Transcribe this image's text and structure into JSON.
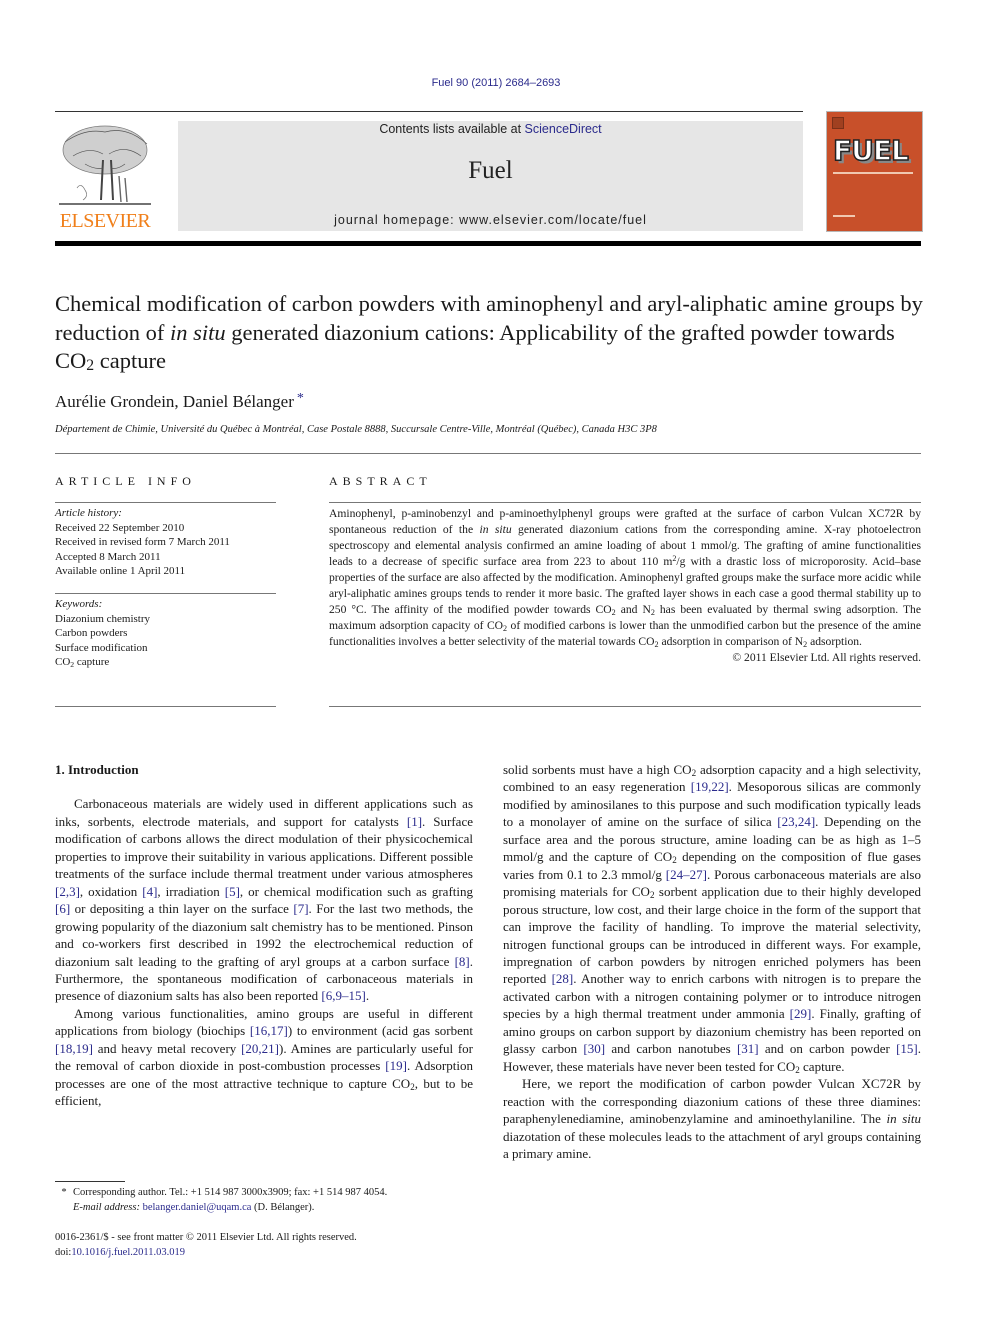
{
  "header": {
    "citation": "Fuel 90 (2011) 2684–2693",
    "contents_prefix": "Contents lists available at ",
    "contents_link": "ScienceDirect",
    "journal_name": "Fuel",
    "homepage": "journal homepage: www.elsevier.com/locate/fuel",
    "publisher_logo_text": "ELSEVIER",
    "cover_title": "FUEL",
    "colors": {
      "publisher_orange": "#f07f1a",
      "cover_background": "#c8502a",
      "banner_gray": "#e6e6e6",
      "link_blue": "#2b2b8c"
    }
  },
  "article": {
    "title_part1": "Chemical modification of carbon powders with aminophenyl and aryl-aliphatic amine groups by reduction of ",
    "title_italic": "in situ",
    "title_part2": " generated diazonium cations: Applicability of the grafted powder towards CO",
    "title_sub": "2",
    "title_part3": " capture",
    "authors": "Aurélie Grondein, Daniel Bélanger",
    "author_marker": "*",
    "affiliation": "Département de Chimie, Université du Québec à Montréal, Case Postale 8888, Succursale Centre-Ville, Montréal (Québec), Canada H3C 3P8"
  },
  "article_info": {
    "heading": "ARTICLE INFO",
    "history_label": "Article history:",
    "history": [
      "Received 22 September 2010",
      "Received in revised form 7 March 2011",
      "Accepted 8 March 2011",
      "Available online 1 April 2011"
    ],
    "keywords_label": "Keywords:",
    "keywords": [
      "Diazonium chemistry",
      "Carbon powders",
      "Surface modification"
    ],
    "keyword_last_a": "CO",
    "keyword_last_sub": "2",
    "keyword_last_b": " capture"
  },
  "abstract": {
    "heading": "ABSTRACT",
    "s1": "Aminophenyl, p-aminobenzyl and p-aminoethylphenyl groups were grafted at the surface of carbon Vulcan XC72R by spontaneous reduction of the ",
    "s1_italic": "in situ",
    "s2": " generated diazonium cations from the corresponding amine. X-ray photoelectron spectroscopy and elemental analysis confirmed an amine loading of about 1 mmol/g. The grafting of amine functionalities leads to a decrease of specific surface area from 223 to about 110 m",
    "s2_sup": "2",
    "s3": "/g with a drastic loss of microporosity. Acid–base properties of the surface are also affected by the modification. Aminophenyl grafted groups make the surface more acidic while aryl-aliphatic amines groups tends to render it more basic. The grafted layer shows in each case a good thermal stability up to 250 °C. The affinity of the modified powder towards CO",
    "s4": " and N",
    "s5": " has been evaluated by thermal swing adsorption. The maximum adsorption capacity of CO",
    "s6": " of modified carbons is lower than the unmodified carbon but the presence of the amine functionalities involves a better selectivity of the material towards CO",
    "s7": " adsorption in comparison of N",
    "s8": " adsorption.",
    "sub": "2",
    "copyright": "© 2011 Elsevier Ltd. All rights reserved."
  },
  "body": {
    "section_heading": "1. Introduction",
    "p1": [
      {
        "t": "Carbonaceous materials are widely used in different applications such as inks, sorbents, electrode materials, and support for catalysts "
      },
      {
        "r": "[1]"
      },
      {
        "t": ". Surface modification of carbons allows the direct modulation of their physicochemical properties to improve their suitability in various applications. Different possible treatments of the surface include thermal treatment under various atmospheres "
      },
      {
        "r": "[2,3]"
      },
      {
        "t": ", oxidation "
      },
      {
        "r": "[4]"
      },
      {
        "t": ", irradiation "
      },
      {
        "r": "[5]"
      },
      {
        "t": ", or chemical modification such as grafting "
      },
      {
        "r": "[6]"
      },
      {
        "t": " or depositing a thin layer on the surface "
      },
      {
        "r": "[7]"
      },
      {
        "t": ". For the last two methods, the growing popularity of the diazonium salt chemistry has to be mentioned. Pinson and co-workers first described in 1992 the electrochemical reduction of diazonium salt leading to the grafting of aryl groups at a carbon surface "
      },
      {
        "r": "[8]"
      },
      {
        "t": ". Furthermore, the spontaneous modification of carbonaceous materials in presence of diazonium salts has also been reported "
      },
      {
        "r": "[6,9–15]"
      },
      {
        "t": "."
      }
    ],
    "p2": [
      {
        "t": "Among various functionalities, amino groups are useful in different applications from biology (biochips "
      },
      {
        "r": "[16,17]"
      },
      {
        "t": ") to environment (acid gas sorbent "
      },
      {
        "r": "[18,19]"
      },
      {
        "t": " and heavy metal recovery "
      },
      {
        "r": "[20,21]"
      },
      {
        "t": "). Amines are particularly useful for the removal of carbon dioxide in post-combustion processes "
      },
      {
        "r": "[19]"
      },
      {
        "t": ". Adsorption processes are one of the most attractive technique to capture CO"
      },
      {
        "s": "2"
      },
      {
        "t": ", but to be efficient,"
      }
    ],
    "p3": [
      {
        "t": "solid sorbents must have a high CO"
      },
      {
        "s": "2"
      },
      {
        "t": " adsorption capacity and a high selectivity, combined to an easy regeneration "
      },
      {
        "r": "[19,22]"
      },
      {
        "t": ". Mesoporous silicas are commonly modified by aminosilanes to this purpose and such modification typically leads to a monolayer of amine on the surface of silica "
      },
      {
        "r": "[23,24]"
      },
      {
        "t": ". Depending on the surface area and the porous structure, amine loading can be as high as 1–5 mmol/g and the capture of CO"
      },
      {
        "s": "2"
      },
      {
        "t": " depending on the composition of flue gases varies from 0.1 to 2.3 mmol/g "
      },
      {
        "r": "[24–27]"
      },
      {
        "t": ". Porous carbonaceous materials are also promising materials for CO"
      },
      {
        "s": "2"
      },
      {
        "t": " sorbent application due to their highly developed porous structure, low cost, and their large choice in the form of the support that can improve the facility of handling. To improve the material selectivity, nitrogen functional groups can be introduced in different ways. For example, impregnation of carbon powders by nitrogen enriched polymers has been reported "
      },
      {
        "r": "[28]"
      },
      {
        "t": ". Another way to enrich carbons with nitrogen is to prepare the activated carbon with a nitrogen containing polymer or to introduce nitrogen species by a high thermal treatment under ammonia "
      },
      {
        "r": "[29]"
      },
      {
        "t": ". Finally, grafting of amino groups on carbon support by diazonium chemistry has been reported on glassy carbon "
      },
      {
        "r": "[30]"
      },
      {
        "t": " and carbon nanotubes "
      },
      {
        "r": "[31]"
      },
      {
        "t": " and on carbon powder "
      },
      {
        "r": "[15]"
      },
      {
        "t": ". However, these materials have never been tested for CO"
      },
      {
        "s": "2"
      },
      {
        "t": " capture."
      }
    ],
    "p4": [
      {
        "t": "Here, we report the modification of carbon powder Vulcan XC72R by reaction with the corresponding diazonium cations of these three diamines: paraphenylenediamine, aminobenzylamine and aminoethylaniline. The "
      },
      {
        "i": "in situ"
      },
      {
        "t": " diazotation of these molecules leads to the attachment of aryl groups containing a primary amine."
      }
    ]
  },
  "footnote": {
    "marker": "*",
    "corresponding": "Corresponding author. Tel.: +1 514 987 3000x3909; fax: +1 514 987 4054.",
    "email_label": "E-mail address:",
    "email": "belanger.daniel@uqam.ca",
    "email_suffix": " (D. Bélanger).",
    "issn_line": "0016-2361/$ - see front matter © 2011 Elsevier Ltd. All rights reserved.",
    "doi_prefix": "doi:",
    "doi": "10.1016/j.fuel.2011.03.019"
  }
}
